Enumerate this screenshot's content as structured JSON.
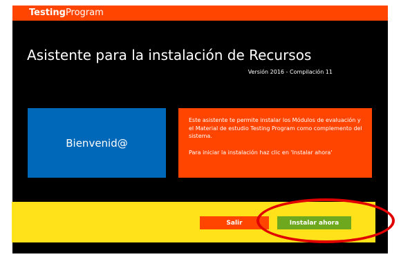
{
  "brand": {
    "bold": "Testing",
    "light": "Program"
  },
  "wizard": {
    "title": "Asistente para la instalación de Recursos",
    "version": "Versión 2016 - Compilación 11"
  },
  "welcome": {
    "text": "Bienvenid@"
  },
  "info": {
    "paragraph1": "Este asistente te permite instalar los Módulos de evaluación y el Material de estudio Testing Program como complemento del sistema.",
    "paragraph2": "Para iniciar la instalación haz clic en 'Instalar ahora'"
  },
  "buttons": {
    "exit": "Salir",
    "install": "Instalar ahora"
  },
  "colors": {
    "titlebar": "#ff4500",
    "background": "#000000",
    "welcome_tile": "#0068b8",
    "info_tile": "#ff4500",
    "bottom_bar": "#ffe21a",
    "exit_button": "#ff4500",
    "install_button": "#6ea81e",
    "highlight_ring": "#e00000"
  }
}
